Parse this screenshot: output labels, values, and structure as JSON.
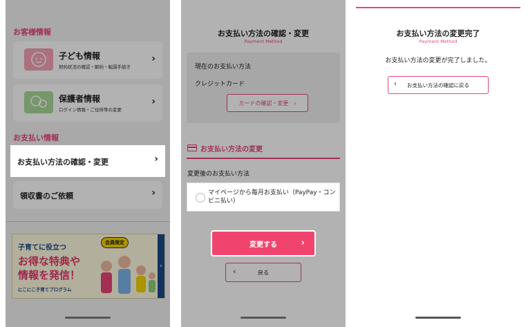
{
  "screen1": {
    "customer_section_title": "お客様情報",
    "child_card": {
      "title": "子ども情報",
      "subtitle": "契約状況の確認・解約・転園手続き",
      "icon": "baby-face-icon",
      "icon_color": "#f5a3b5"
    },
    "guardian_card": {
      "title": "保護者情報",
      "subtitle": "ログイン情報・ご住所等の変更",
      "icon": "parent-child-icon",
      "icon_color": "#a8d89a"
    },
    "payment_section_title": "お支払い情報",
    "payment_row": "お支払い方法の確認・変更",
    "receipt_row": "領収書のご依頼",
    "chevron": "›",
    "banner": {
      "line1": "子育てに役立つ",
      "line2": "お得な特典や",
      "line3": "情報を発信！",
      "badge": "会員限定",
      "footer": "にこにこ子育てプログラム",
      "arrow": "›"
    }
  },
  "screen2": {
    "title": "お支払い方法の確認・変更",
    "subtitle": "Payment Method",
    "current_label": "現在のお支払い方法",
    "current_value": "クレジットカード",
    "card_button": "カードの確認・変更　›",
    "section_head": "お支払い方法の変更",
    "after_label": "変更後のお支払い方法",
    "radio_option": "マイページから毎月お支払い（PayPay・コンビニ払い）",
    "submit_button": "変更する",
    "submit_chevron": "›",
    "back_button": "戻る",
    "back_chevron": "‹"
  },
  "screen3": {
    "title": "お支払い方法の変更完了",
    "subtitle": "Payment Method",
    "message": "お支払い方法の変更が完了しました。",
    "return_button": "お支払い方法の確認に戻る",
    "return_chevron": "‹"
  },
  "colors": {
    "accent": "#e8447a",
    "primary_button": "#f0446e",
    "overlay": "rgba(0,0,0,0.30)"
  }
}
